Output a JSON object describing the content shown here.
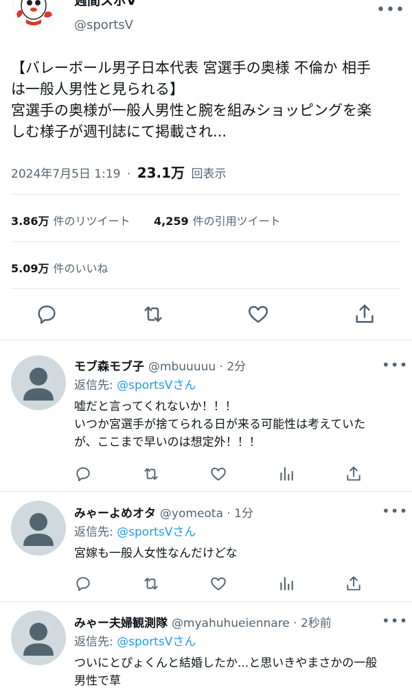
{
  "header": {
    "name": "週間スポV",
    "handle": "@sportsV"
  },
  "main_tweet": {
    "text_line1": "【バレーボール男子日本代表 宮選手の奥様 不倫か 相手",
    "text_line2": "は一般人男性と見られる】",
    "text_line3": "宮選手の奥様が一般人男性と腕を組みショッピングを楽",
    "text_line4": "しむ様子が週刊誌にて掲載され...",
    "date": "2024年7月5日 1:19",
    "separator": "·",
    "views": "23.1万",
    "views_label": "回表示",
    "retweets": "3.86万",
    "retweets_label": "件のリツイート",
    "quotes": "4,259",
    "quotes_label": "件の引用ツイート",
    "likes": "5.09万",
    "likes_label": "件のいいね"
  },
  "replies": [
    {
      "name": "モブ森モブ子",
      "handle": "@mbuuuuu · 2分",
      "reply_prefix": "返信先: ",
      "reply_to": "@sportsVさん",
      "line1": "嘘だと言ってくれないか！！！",
      "line2": "いつか宮選手が捨てられる日が来る可能性は考えていた",
      "line3": "が、ここまで早いのは想定外！！！"
    },
    {
      "name": "みゃーよめオタ",
      "handle": "@yomeota · 1分",
      "reply_prefix": "返信先: ",
      "reply_to": "@sportsVさん",
      "line1": "宮嫁も一般人女性なんだけどな"
    },
    {
      "name": "みゃー夫婦観測隊",
      "handle": "@myahuhueiennare · 2秒前",
      "reply_prefix": "返信先: ",
      "reply_to": "@sportsVさん",
      "line1": "ついにとぴょくんと結婚したか...と思いきやまさかの一般",
      "line2": "男性で草"
    }
  ],
  "icons": {
    "reply": "speech-bubble",
    "retweet": "retweet-arrows",
    "like": "heart",
    "share": "upload-arrow",
    "views": "bar-chart",
    "more": "ellipsis"
  },
  "colors": {
    "link": "#1d9bf0",
    "secondary_text": "#536471",
    "avatar_placeholder": "#cfd9de",
    "mascot_red": "#e0362c"
  }
}
